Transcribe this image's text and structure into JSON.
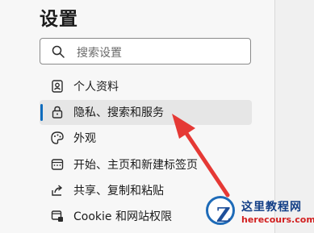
{
  "settings": {
    "title": "设置",
    "search": {
      "placeholder": "搜索设置"
    },
    "menu": [
      {
        "label": "个人资料",
        "icon": "profile-icon",
        "active": false
      },
      {
        "label": "隐私、搜索和服务",
        "icon": "lock-icon",
        "active": true
      },
      {
        "label": "外观",
        "icon": "palette-icon",
        "active": false
      },
      {
        "label": "开始、主页和新建标签页",
        "icon": "new-tab-icon",
        "active": false
      },
      {
        "label": "共享、复制和粘贴",
        "icon": "share-icon",
        "active": false
      },
      {
        "label": "Cookie 和网站权限",
        "icon": "site-permissions-icon",
        "active": false
      }
    ]
  },
  "annotation": {
    "arrow_color": "#e53935",
    "icon": "arrow-annotation"
  },
  "watermark": {
    "title": "这里教程网",
    "url": "herecours.com",
    "logo_letter": "Z"
  },
  "colors": {
    "accent": "#0f6cbd",
    "active_bg": "#e6e6e6"
  }
}
